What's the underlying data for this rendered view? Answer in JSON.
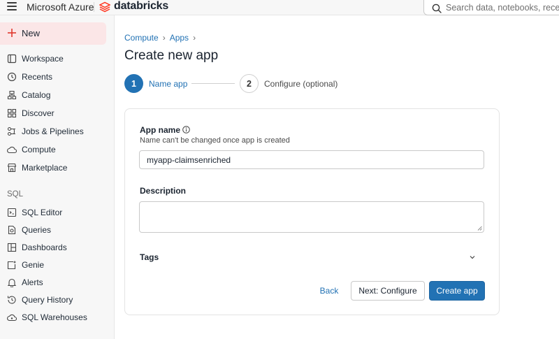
{
  "topbar": {
    "azure_label": "Microsoft Azure",
    "databricks_label": "databricks",
    "search_placeholder": "Search data, notebooks, recents"
  },
  "sidebar": {
    "new_label": "New",
    "items": [
      {
        "label": "Workspace",
        "icon": "workspace-icon"
      },
      {
        "label": "Recents",
        "icon": "clock-icon"
      },
      {
        "label": "Catalog",
        "icon": "catalog-icon"
      },
      {
        "label": "Discover",
        "icon": "grid-icon"
      },
      {
        "label": "Jobs & Pipelines",
        "icon": "jobs-icon"
      },
      {
        "label": "Compute",
        "icon": "cloud-icon"
      },
      {
        "label": "Marketplace",
        "icon": "marketplace-icon"
      }
    ],
    "sql_section_label": "SQL",
    "sql_items": [
      {
        "label": "SQL Editor",
        "icon": "sql-editor-icon"
      },
      {
        "label": "Queries",
        "icon": "queries-icon"
      },
      {
        "label": "Dashboards",
        "icon": "dashboards-icon"
      },
      {
        "label": "Genie",
        "icon": "genie-icon"
      },
      {
        "label": "Alerts",
        "icon": "bell-icon"
      },
      {
        "label": "Query History",
        "icon": "history-icon"
      },
      {
        "label": "SQL Warehouses",
        "icon": "warehouse-icon"
      }
    ]
  },
  "breadcrumb": {
    "items": [
      "Compute",
      "Apps"
    ],
    "separator": "›"
  },
  "page_title": "Create new app",
  "stepper": {
    "steps": [
      {
        "number": "1",
        "label": "Name app",
        "active": true
      },
      {
        "number": "2",
        "label": "Configure (optional)",
        "active": false
      }
    ]
  },
  "form": {
    "app_name_label": "App name",
    "app_name_help": "Name can't be changed once app is created",
    "app_name_value": "myapp-claimsenriched",
    "description_label": "Description",
    "description_value": "",
    "tags_label": "Tags"
  },
  "actions": {
    "back_label": "Back",
    "next_label": "Next: Configure",
    "create_label": "Create app"
  },
  "colors": {
    "accent": "#2272b4",
    "new_button_bg": "#fbe6e7",
    "brand_red": "#ff3621"
  }
}
